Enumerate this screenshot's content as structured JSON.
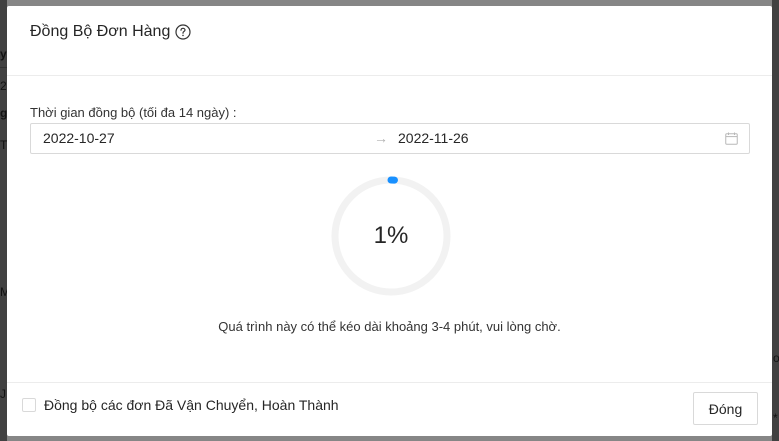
{
  "background": {
    "fragments": [
      "y",
      "2",
      "g",
      "T",
      "M",
      "J",
      "o",
      "*"
    ]
  },
  "modal": {
    "title": "Đồng Bộ Đơn Hàng",
    "help_icon": "question-circle-icon",
    "date_field": {
      "label": "Thời gian đồng bộ (tối đa 14 ngày) :",
      "start_date": "2022-10-27",
      "arrow": "→",
      "end_date": "2022-11-26",
      "icon": "calendar-icon"
    },
    "progress": {
      "percent": 1,
      "label": "1%",
      "color": "#1890ff",
      "track_color": "#f2f2f2"
    },
    "note": "Quá trình này có thể kéo dài khoảng 3-4 phút, vui lòng chờ.",
    "footer": {
      "checkbox_label": "Đồng bộ các đơn Đã Vận Chuyển, Hoàn Thành",
      "checkbox_checked": false,
      "close_label": "Đóng"
    }
  }
}
